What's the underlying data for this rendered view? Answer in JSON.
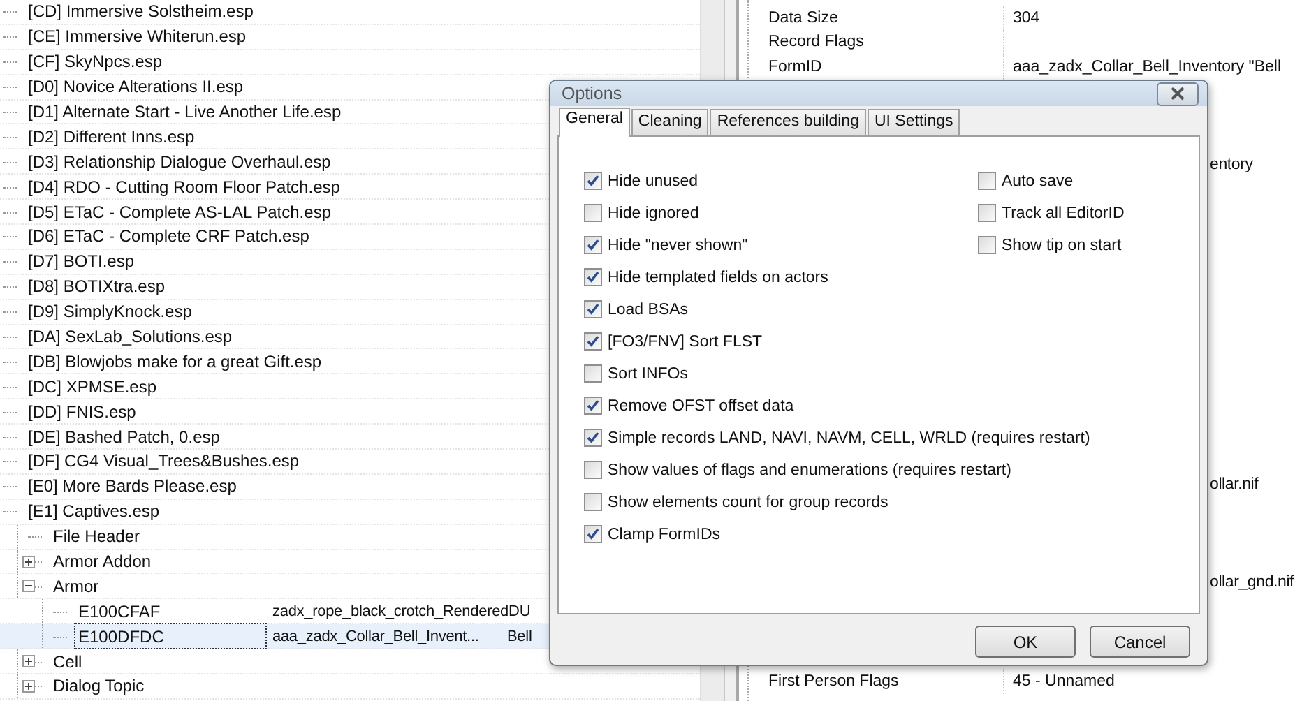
{
  "tree": [
    {
      "label": "[CD] Immersive Solstheim.esp",
      "selected": false
    },
    {
      "label": "[CE] Immersive Whiterun.esp",
      "selected": false
    },
    {
      "label": "[CF] SkyNpcs.esp",
      "selected": false
    },
    {
      "label": "[D0] Novice Alterations II.esp",
      "selected": false
    },
    {
      "label": "[D1] Alternate Start - Live Another Life.esp",
      "selected": false
    },
    {
      "label": "[D2] Different Inns.esp",
      "selected": false
    },
    {
      "label": "[D3] Relationship Dialogue Overhaul.esp",
      "selected": false
    },
    {
      "label": "[D4] RDO - Cutting Room Floor Patch.esp",
      "selected": false
    },
    {
      "label": "[D5] ETaC - Complete AS-LAL Patch.esp",
      "selected": false
    },
    {
      "label": "[D6] ETaC - Complete CRF Patch.esp",
      "selected": false
    },
    {
      "label": "[D7] BOTI.esp",
      "selected": false
    },
    {
      "label": "[D8] BOTIXtra.esp",
      "selected": false
    },
    {
      "label": "[D9] SimplyKnock.esp",
      "selected": false
    },
    {
      "label": "[DA] SexLab_Solutions.esp",
      "selected": false
    },
    {
      "label": "[DB] Blowjobs make for a great Gift.esp",
      "selected": false
    },
    {
      "label": "[DC] XPMSE.esp",
      "selected": false
    },
    {
      "label": "[DD] FNIS.esp",
      "selected": false
    },
    {
      "label": "[DE] Bashed Patch, 0.esp",
      "selected": false
    },
    {
      "label": "[DF] CG4 Visual_Trees&Bushes.esp",
      "selected": false
    },
    {
      "label": "[E0] More Bards Please.esp",
      "selected": false
    },
    {
      "label": "[E1] Captives.esp",
      "selected": false,
      "children": [
        {
          "label": "File Header",
          "selected": false
        },
        {
          "label": "Armor Addon",
          "selected": false,
          "expanded": false
        },
        {
          "label": "Armor",
          "selected": false,
          "expanded": true,
          "children": [
            {
              "label": "E100CFAF",
              "selected": false,
              "cells": [
                "zadx_rope_black_crotch_RenderedDU"
              ]
            },
            {
              "label": "E100DFDC",
              "selected": true,
              "cells": [
                "aaa_zadx_Collar_Bell_Invent...",
                "Bell"
              ]
            }
          ]
        },
        {
          "label": "Cell",
          "selected": false,
          "expanded": false
        },
        {
          "label": "Dialog Topic",
          "selected": false,
          "expanded": false
        }
      ]
    }
  ],
  "details": [
    {
      "kind": "field",
      "label": "Data Size",
      "value": "304"
    },
    {
      "kind": "field",
      "label": "Record Flags"
    },
    {
      "kind": "field",
      "label": "FormID",
      "value": "aaa_zadx_Collar_Bell_Inventory \"Bell"
    },
    {
      "kind": "covered"
    },
    {
      "kind": "covered"
    },
    {
      "kind": "covered"
    },
    {
      "kind": "tail",
      "value": "entory"
    },
    {
      "kind": "covered"
    },
    {
      "kind": "covered"
    },
    {
      "kind": "covered"
    },
    {
      "kind": "covered"
    },
    {
      "kind": "covered"
    },
    {
      "kind": "covered"
    },
    {
      "kind": "covered"
    },
    {
      "kind": "covered"
    },
    {
      "kind": "covered"
    },
    {
      "kind": "covered"
    },
    {
      "kind": "covered"
    },
    {
      "kind": "covered"
    },
    {
      "kind": "tail",
      "value": "ollar.nif"
    },
    {
      "kind": "covered"
    },
    {
      "kind": "covered"
    },
    {
      "kind": "covered"
    },
    {
      "kind": "tail",
      "value": "ollar_gnd.nif"
    },
    {
      "kind": "covered"
    },
    {
      "kind": "covered"
    },
    {
      "kind": "covered"
    },
    {
      "kind": "field",
      "label": "First Person Flags",
      "value": "45 - Unnamed"
    }
  ],
  "dialog": {
    "title": "Options",
    "tabs": [
      {
        "label": "General",
        "selected": true
      },
      {
        "label": "Cleaning",
        "selected": false
      },
      {
        "label": "References building",
        "selected": false
      },
      {
        "label": "UI Settings",
        "selected": false
      }
    ],
    "left_options": [
      {
        "label": "Hide unused",
        "checked": true
      },
      {
        "label": "Hide ignored",
        "checked": false
      },
      {
        "label": "Hide \"never shown\"",
        "checked": true
      },
      {
        "label": "Hide templated fields on actors",
        "checked": true
      },
      {
        "label": "Load BSAs",
        "checked": true
      },
      {
        "label": "[FO3/FNV] Sort FLST",
        "checked": true
      },
      {
        "label": "Sort INFOs",
        "checked": false
      },
      {
        "label": "Remove OFST offset data",
        "checked": true
      },
      {
        "label": "Simple records LAND, NAVI, NAVM, CELL, WRLD (requires restart)",
        "checked": true
      },
      {
        "label": "Show values of flags and enumerations (requires restart)",
        "checked": false
      },
      {
        "label": "Show elements count for group records",
        "checked": false
      },
      {
        "label": "Clamp FormIDs",
        "checked": true
      }
    ],
    "right_options": [
      {
        "label": "Auto save",
        "checked": false
      },
      {
        "label": "Track all EditorID",
        "checked": false
      },
      {
        "label": "Show tip on start",
        "checked": false
      }
    ],
    "buttons": [
      "OK",
      "Cancel"
    ]
  }
}
